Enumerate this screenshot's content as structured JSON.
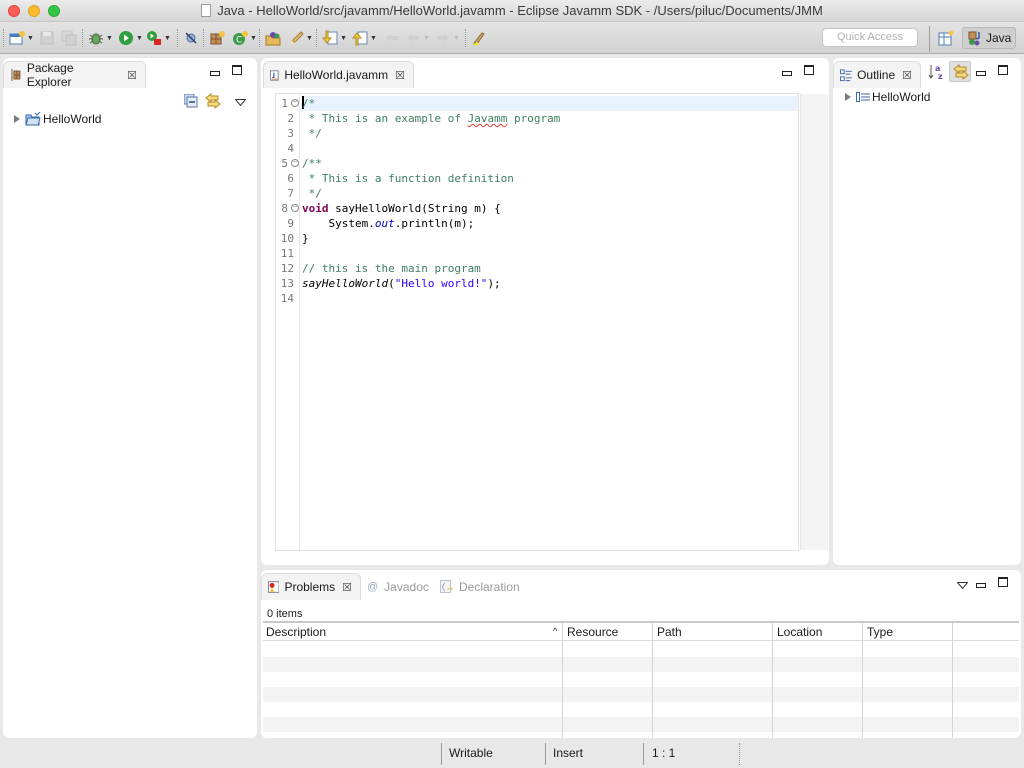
{
  "window": {
    "title": "Java - HelloWorld/src/javamm/HelloWorld.javamm - Eclipse Javamm SDK - /Users/piluc/Documents/JMM"
  },
  "toolbar": {
    "icons": [
      "new-wizard-icon",
      "save-icon",
      "save-all-icon",
      "debug-icon",
      "run-icon",
      "run-external-tools-icon",
      "skip-breakpoints-icon",
      "new-package-icon",
      "new-class-icon",
      "open-type-icon",
      "open-task-icon",
      "next-annotation-icon",
      "previous-annotation-icon",
      "last-edit-location-icon",
      "back-icon",
      "forward-icon",
      "highlight-icon"
    ],
    "quick_access_placeholder": "Quick Access",
    "perspective_label": "Java"
  },
  "package_explorer": {
    "tab_label": "Package Explorer",
    "tree": [
      {
        "label": "HelloWorld",
        "icon": "project-folder-icon",
        "expanded": false
      }
    ]
  },
  "editor": {
    "tab_label": "HelloWorld.javamm",
    "lines": [
      {
        "n": "1",
        "fold": true,
        "text": "/*",
        "kind": "comment"
      },
      {
        "n": "2",
        "fold": false,
        "text": " * This is an example of Javamm program",
        "kind": "comment"
      },
      {
        "n": "3",
        "fold": false,
        "text": " */",
        "kind": "comment"
      },
      {
        "n": "4",
        "fold": false,
        "text": "",
        "kind": "plain"
      },
      {
        "n": "5",
        "fold": true,
        "text": "/**",
        "kind": "comment"
      },
      {
        "n": "6",
        "fold": false,
        "text": " * This is a function definition",
        "kind": "comment"
      },
      {
        "n": "7",
        "fold": false,
        "text": " */",
        "kind": "comment"
      },
      {
        "n": "8",
        "fold": true,
        "text": "void sayHelloWorld(String m) {",
        "kind": "code"
      },
      {
        "n": "9",
        "fold": false,
        "text": "    System.out.println(m);",
        "kind": "code"
      },
      {
        "n": "10",
        "fold": false,
        "text": "}",
        "kind": "code"
      },
      {
        "n": "11",
        "fold": false,
        "text": "",
        "kind": "plain"
      },
      {
        "n": "12",
        "fold": false,
        "text": "// this is the main program",
        "kind": "comment"
      },
      {
        "n": "13",
        "fold": false,
        "text": "sayHelloWorld(\"Hello world!\");",
        "kind": "code"
      },
      {
        "n": "14",
        "fold": false,
        "text": "",
        "kind": "plain"
      }
    ],
    "tokens": {
      "l2_pre": " * This is an example of ",
      "l2_spell": "Javamm",
      "l2_post": " program",
      "l8_kw": "void",
      "l8_rest": " sayHelloWorld(String m) {",
      "l9_pre": "    System.",
      "l9_field": "out",
      "l9_post": ".println(m);",
      "l13_call": "sayHelloWorld",
      "l13_open": "(",
      "l13_str": "\"Hello world!\"",
      "l13_close": ");"
    }
  },
  "outline": {
    "tab_label": "Outline",
    "tree": [
      {
        "label": "HelloWorld",
        "icon": "program-icon",
        "expanded": false
      }
    ]
  },
  "problems": {
    "tabs": [
      {
        "label": "Problems",
        "active": true
      },
      {
        "label": "Javadoc",
        "active": false
      },
      {
        "label": "Declaration",
        "active": false
      }
    ],
    "items_count": "0 items",
    "columns": [
      "Description",
      "Resource",
      "Path",
      "Location",
      "Type"
    ],
    "rows": []
  },
  "statusbar": {
    "writable": "Writable",
    "insert_mode": "Insert",
    "cursor_position": "1 : 1"
  }
}
